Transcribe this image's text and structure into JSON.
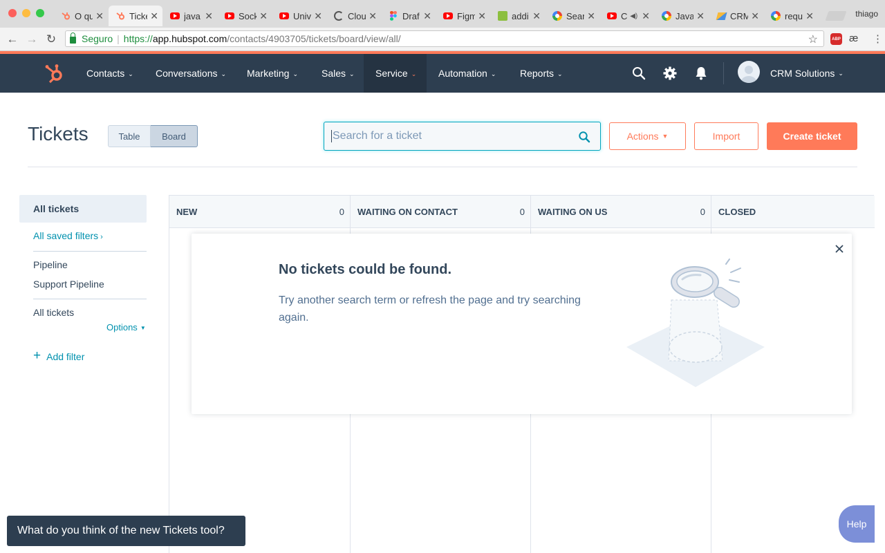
{
  "browser": {
    "tabs": [
      {
        "title": "O qu",
        "icon": "hubspot-icon"
      },
      {
        "title": "Ticke",
        "icon": "hubspot-icon"
      },
      {
        "title": "java",
        "icon": "youtube-icon"
      },
      {
        "title": "Sock",
        "icon": "youtube-icon"
      },
      {
        "title": "Univ",
        "icon": "youtube-icon"
      },
      {
        "title": "Clou",
        "icon": "loading-icon"
      },
      {
        "title": "Draf",
        "icon": "figma-icon"
      },
      {
        "title": "Figm",
        "icon": "youtube-icon"
      },
      {
        "title": "addi",
        "icon": "alfresco-icon"
      },
      {
        "title": "Sear",
        "icon": "google-web-icon"
      },
      {
        "title": "C",
        "icon": "youtube-icon"
      },
      {
        "title": "Java",
        "icon": "google-web-icon"
      },
      {
        "title": "CRM",
        "icon": "crm-icon"
      },
      {
        "title": "requ",
        "icon": "google-icon"
      }
    ],
    "profile": "thiago",
    "secure_label": "Seguro",
    "url_https": "https://",
    "url_host": "app.hubspot.com",
    "url_path": "/contacts/4903705/tickets/board/view/all/",
    "ext_abp": "ABP",
    "ext_ae": "æ"
  },
  "nav": {
    "items": [
      "Contacts",
      "Conversations",
      "Marketing",
      "Sales",
      "Service",
      "Automation",
      "Reports"
    ],
    "account": "CRM Solutions"
  },
  "header": {
    "title": "Tickets",
    "view_table": "Table",
    "view_board": "Board",
    "search_placeholder": "Search for a ticket",
    "actions": "Actions",
    "import": "Import",
    "create": "Create ticket"
  },
  "sidebar": {
    "all_tickets": "All tickets",
    "saved_filters": "All saved filters",
    "pipeline_label": "Pipeline",
    "pipeline_value": "Support Pipeline",
    "view_label": "All tickets",
    "options": "Options",
    "add_filter": "Add filter"
  },
  "board": {
    "columns": [
      {
        "name": "NEW",
        "count": "0"
      },
      {
        "name": "WAITING ON CONTACT",
        "count": "0"
      },
      {
        "name": "WAITING ON US",
        "count": "0"
      },
      {
        "name": "CLOSED",
        "count": ""
      }
    ]
  },
  "empty_state": {
    "title": "No tickets could be found.",
    "description": "Try another search term or refresh the page and try searching again."
  },
  "feedback": "What do you think of the new Tickets tool?",
  "help": "Help",
  "colors": {
    "accent": "#ff7a59",
    "nav_bg": "#2d3e50",
    "link": "#0091ae",
    "search_border": "#00a4bd"
  }
}
